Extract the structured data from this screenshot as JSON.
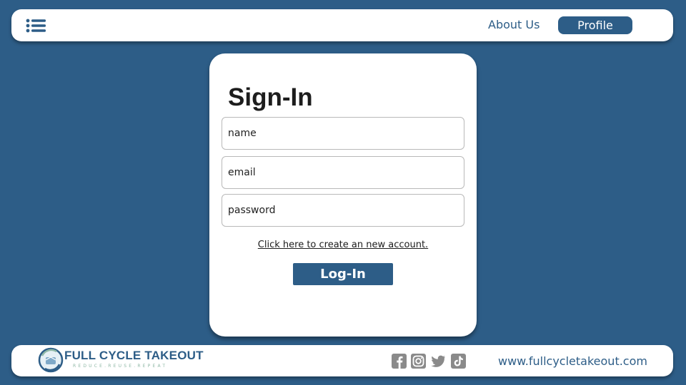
{
  "header": {
    "menu_icon": "menu-list-icon",
    "nav": {
      "about_label": "About Us",
      "profile_label": "Profile"
    }
  },
  "signin": {
    "title": "Sign-In",
    "fields": {
      "name_placeholder": "name",
      "email_placeholder": "email",
      "password_placeholder": "password"
    },
    "create_account_link": "Click here to create an new account.",
    "login_label": "Log-In"
  },
  "footer": {
    "brand_name": "FULL CYCLE TAKEOUT",
    "brand_tagline": "REDUCE.REUSE.REPEAT",
    "social_icons": [
      "facebook-icon",
      "instagram-icon",
      "twitter-icon",
      "tiktok-icon"
    ],
    "website": "www.fullcycletakeout.com"
  },
  "colors": {
    "primary": "#2d5d87",
    "surface": "#ffffff",
    "social_icon": "#8a8a8a",
    "tagline": "#8fb8a6"
  }
}
